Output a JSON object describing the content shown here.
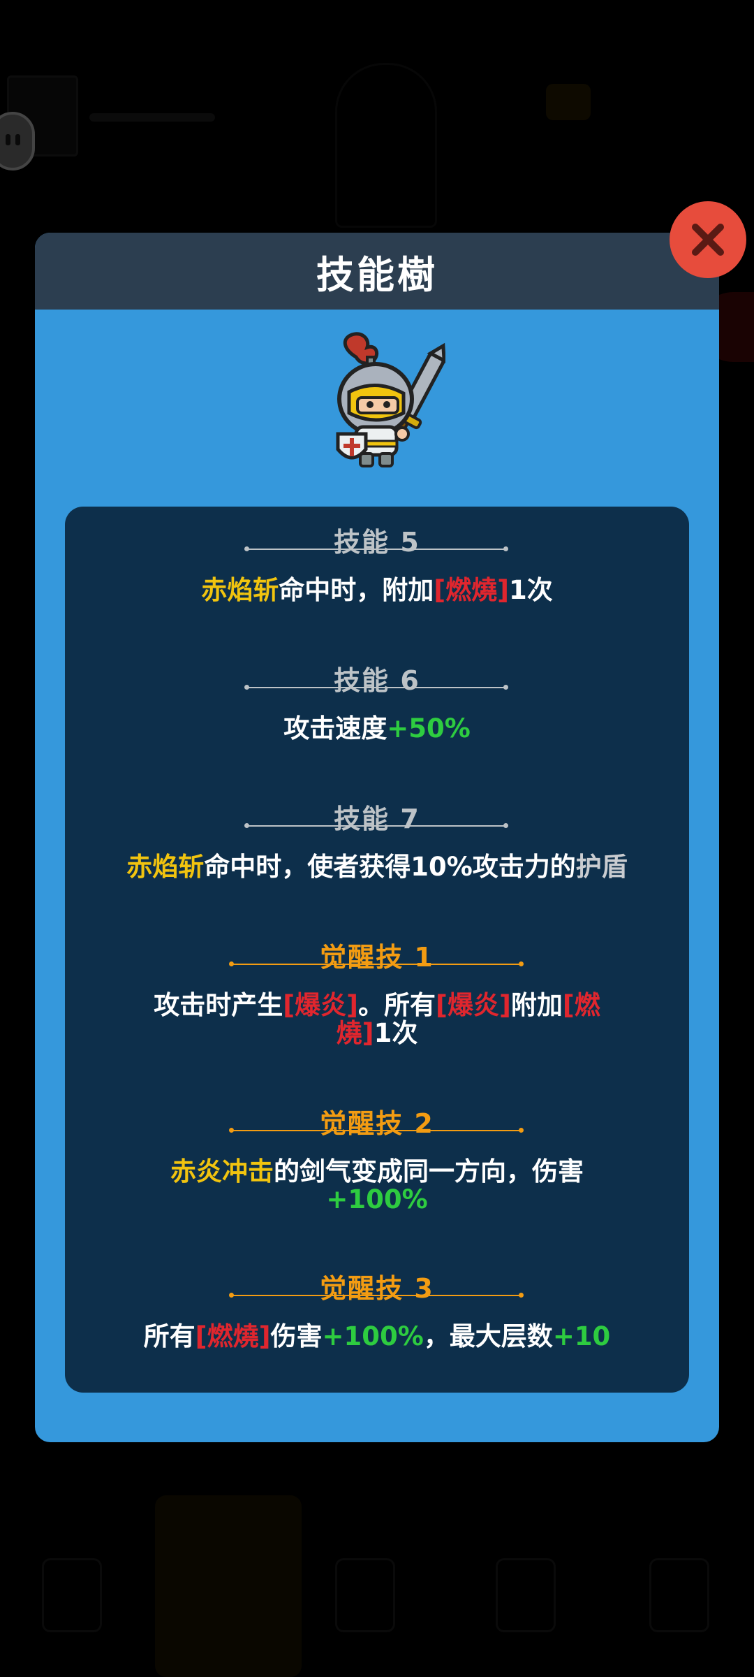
{
  "modal": {
    "title": "技能樹"
  },
  "skills": [
    {
      "heading": "技能 5",
      "kind": "normal",
      "desc": [
        {
          "text": "赤焰斩",
          "color": "gold"
        },
        {
          "text": "命中时，附加",
          "color": "white"
        },
        {
          "text": "[燃燒]",
          "color": "red"
        },
        {
          "text": "1次",
          "color": "white"
        }
      ]
    },
    {
      "heading": "技能 6",
      "kind": "normal",
      "desc": [
        {
          "text": "攻击速度",
          "color": "white"
        },
        {
          "text": "+50%",
          "color": "green"
        }
      ]
    },
    {
      "heading": "技能 7",
      "kind": "normal",
      "desc": [
        {
          "text": "赤焰斩",
          "color": "gold"
        },
        {
          "text": "命中时，使者获得10%攻击力的",
          "color": "white"
        },
        {
          "text": "护盾",
          "color": "grey"
        }
      ]
    },
    {
      "heading": "觉醒技 1",
      "kind": "awakening",
      "desc": [
        {
          "text": "攻击时产生",
          "color": "white"
        },
        {
          "text": "[爆炎]",
          "color": "red"
        },
        {
          "text": "。所有",
          "color": "white"
        },
        {
          "text": "[爆炎]",
          "color": "red"
        },
        {
          "text": "附加",
          "color": "white"
        },
        {
          "text": "[燃燒]",
          "color": "red"
        },
        {
          "text": "1次",
          "color": "white"
        }
      ]
    },
    {
      "heading": "觉醒技 2",
      "kind": "awakening",
      "desc": [
        {
          "text": "赤炎冲击",
          "color": "gold"
        },
        {
          "text": "的剑气变成同一方向，伤害",
          "color": "white"
        },
        {
          "text": "+100%",
          "color": "green"
        }
      ]
    },
    {
      "heading": "觉醒技 3",
      "kind": "awakening",
      "desc": [
        {
          "text": "所有",
          "color": "white"
        },
        {
          "text": "[燃燒]",
          "color": "red"
        },
        {
          "text": "伤害",
          "color": "white"
        },
        {
          "text": "+100%",
          "color": "green"
        },
        {
          "text": "，最大层数",
          "color": "white"
        },
        {
          "text": "+10",
          "color": "green"
        }
      ]
    }
  ],
  "colors": {
    "modal_bg": "#3598dc",
    "header_bg": "#2c3e50",
    "panel_bg": "#0d2f4b",
    "close_button": "#e74c3c",
    "skill_name": "#f1c40f",
    "status_effect": "#e0262e",
    "bonus": "#2ecc40",
    "awakening_heading": "#f39c12",
    "normal_heading": "#bdc3c7"
  },
  "icons": {
    "close": "close-x-icon",
    "hero": "knight-hero-portrait"
  }
}
